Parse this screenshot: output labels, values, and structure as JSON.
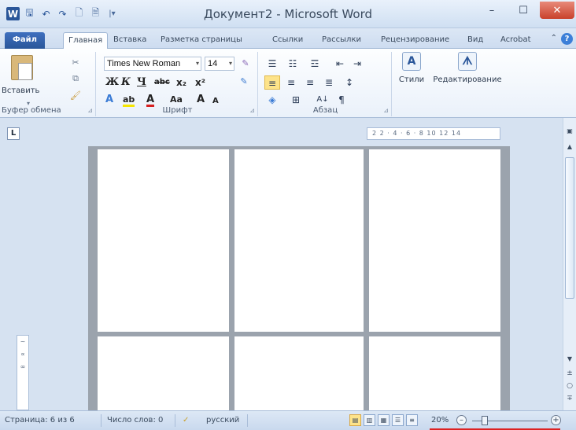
{
  "window": {
    "title": "Документ2 - Microsoft Word",
    "quick_access": {
      "logo": "W",
      "save": "🖫",
      "undo": "↶",
      "redo": "↷",
      "new": "🗋",
      "preview": "🗎",
      "customize": "|▾"
    },
    "controls": {
      "minimize": "–",
      "maximize": "☐",
      "close": "✕"
    }
  },
  "tabs": [
    {
      "label": "Файл"
    },
    {
      "label": "Главная"
    },
    {
      "label": "Вставка"
    },
    {
      "label": "Разметка страницы"
    },
    {
      "label": "Ссылки"
    },
    {
      "label": "Рассылки"
    },
    {
      "label": "Рецензирование"
    },
    {
      "label": "Вид"
    },
    {
      "label": "Acrobat"
    }
  ],
  "tab_extras": {
    "collapse": "⌃",
    "help": "?"
  },
  "ribbon": {
    "clipboard": {
      "label": "Буфер обмена",
      "paste_label": "Вставить",
      "paste_arrow": "▾"
    },
    "font": {
      "label": "Шрифт",
      "font_name": "Times New Roman",
      "font_size": "14",
      "bold": "Ж",
      "italic": "К",
      "underline": "Ч",
      "strike": "abc",
      "subscript": "x₂",
      "superscript": "x²",
      "grow": "A",
      "shrink": "A",
      "case": "Aa",
      "clear": "A",
      "highlight": "ab",
      "color": "A"
    },
    "paragraph": {
      "label": "Абзац",
      "pilcrow": "¶",
      "sort": "A↓"
    },
    "styles": {
      "label": "Стили",
      "icon": "A"
    },
    "editing": {
      "label": "Редактирование",
      "icon": "ᗑ"
    },
    "launcher": "⊿"
  },
  "ruler": {
    "tab_selector": "L",
    "marks": "2  2 · 4 · 6 · 8 10 12 14",
    "view_ruler": "▣"
  },
  "vruler": {
    "marks": "~ ∝ ∞"
  },
  "scroll": {
    "up": "▲",
    "down": "▼",
    "prev": "±",
    "browse": "○",
    "next": "∓"
  },
  "status": {
    "page": "Страница: 6 из 6",
    "words": "Число слов: 0",
    "language": "русский",
    "zoom": "20%",
    "zoom_out": "–",
    "zoom_in": "+"
  }
}
